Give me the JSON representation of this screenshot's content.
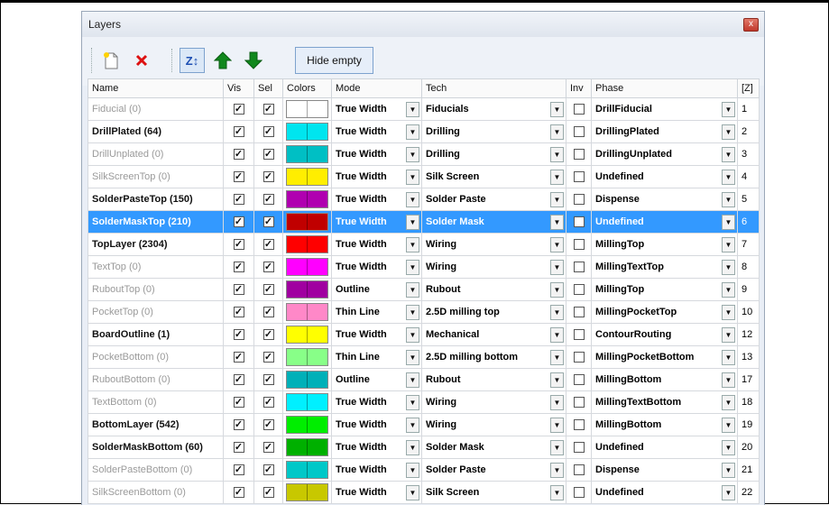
{
  "window": {
    "title": "Layers",
    "close_label": "x"
  },
  "toolbar": {
    "hide_empty_label": "Hide empty",
    "sort_label": "Z↕"
  },
  "columns": [
    "Name",
    "Vis",
    "Sel",
    "Colors",
    "Mode",
    "Tech",
    "Inv",
    "Phase",
    "[Z]"
  ],
  "rows": [
    {
      "name": "Fiducial (0)",
      "empty": true,
      "vis": true,
      "sel": true,
      "colors": [
        "#ffffff",
        "#ffffff"
      ],
      "mode": "True Width",
      "tech": "Fiducials",
      "inv": false,
      "phase": "DrillFiducial",
      "z": "1"
    },
    {
      "name": "DrillPlated (64)",
      "empty": false,
      "vis": true,
      "sel": true,
      "colors": [
        "#00e5ef",
        "#00e5ef"
      ],
      "mode": "True Width",
      "tech": "Drilling",
      "inv": false,
      "phase": "DrillingPlated",
      "z": "2"
    },
    {
      "name": "DrillUnplated (0)",
      "empty": true,
      "vis": true,
      "sel": true,
      "colors": [
        "#00bfc4",
        "#00bfc4"
      ],
      "mode": "True Width",
      "tech": "Drilling",
      "inv": false,
      "phase": "DrillingUnplated",
      "z": "3"
    },
    {
      "name": "SilkScreenTop (0)",
      "empty": true,
      "vis": true,
      "sel": true,
      "colors": [
        "#ffee00",
        "#ffee00"
      ],
      "mode": "True Width",
      "tech": "Silk Screen",
      "inv": false,
      "phase": "Undefined",
      "z": "4"
    },
    {
      "name": "SolderPasteTop (150)",
      "empty": false,
      "vis": true,
      "sel": true,
      "colors": [
        "#b000b0",
        "#b000b0"
      ],
      "mode": "True Width",
      "tech": "Solder Paste",
      "inv": false,
      "phase": "Dispense",
      "z": "5"
    },
    {
      "name": "SolderMaskTop (210)",
      "empty": false,
      "selected": true,
      "vis": true,
      "sel": true,
      "colors": [
        "#c00000",
        "#c00000"
      ],
      "mode": "True Width",
      "tech": "Solder Mask",
      "inv": false,
      "phase": "Undefined",
      "z": "6"
    },
    {
      "name": "TopLayer (2304)",
      "empty": false,
      "vis": true,
      "sel": true,
      "colors": [
        "#ff0000",
        "#ff0000"
      ],
      "mode": "True Width",
      "tech": "Wiring",
      "inv": false,
      "phase": "MillingTop",
      "z": "7"
    },
    {
      "name": "TextTop (0)",
      "empty": true,
      "vis": true,
      "sel": true,
      "colors": [
        "#ff00ff",
        "#ff00ff"
      ],
      "mode": "True Width",
      "tech": "Wiring",
      "inv": false,
      "phase": "MillingTextTop",
      "z": "8"
    },
    {
      "name": "RuboutTop (0)",
      "empty": true,
      "vis": true,
      "sel": true,
      "colors": [
        "#a000a0",
        "#a000a0"
      ],
      "mode": "Outline",
      "tech": "Rubout",
      "inv": false,
      "phase": "MillingTop",
      "z": "9"
    },
    {
      "name": "PocketTop (0)",
      "empty": true,
      "vis": true,
      "sel": true,
      "colors": [
        "#ff88c8",
        "#ff88c8"
      ],
      "mode": "Thin Line",
      "tech": "2.5D milling top",
      "inv": false,
      "phase": "MillingPocketTop",
      "z": "10"
    },
    {
      "name": "BoardOutline (1)",
      "empty": false,
      "vis": true,
      "sel": true,
      "colors": [
        "#ffff00",
        "#ffff00"
      ],
      "mode": "True Width",
      "tech": "Mechanical",
      "inv": false,
      "phase": "ContourRouting",
      "z": "12"
    },
    {
      "name": "PocketBottom (0)",
      "empty": true,
      "vis": true,
      "sel": true,
      "colors": [
        "#88ff88",
        "#88ff88"
      ],
      "mode": "Thin Line",
      "tech": "2.5D milling bottom",
      "inv": false,
      "phase": "MillingPocketBottom",
      "z": "13"
    },
    {
      "name": "RuboutBottom (0)",
      "empty": true,
      "vis": true,
      "sel": true,
      "colors": [
        "#00b0b8",
        "#00b0b8"
      ],
      "mode": "Outline",
      "tech": "Rubout",
      "inv": false,
      "phase": "MillingBottom",
      "z": "17"
    },
    {
      "name": "TextBottom (0)",
      "empty": true,
      "vis": true,
      "sel": true,
      "colors": [
        "#00f0ff",
        "#00f0ff"
      ],
      "mode": "True Width",
      "tech": "Wiring",
      "inv": false,
      "phase": "MillingTextBottom",
      "z": "18"
    },
    {
      "name": "BottomLayer (542)",
      "empty": false,
      "vis": true,
      "sel": true,
      "colors": [
        "#00ee00",
        "#00ee00"
      ],
      "mode": "True Width",
      "tech": "Wiring",
      "inv": false,
      "phase": "MillingBottom",
      "z": "19"
    },
    {
      "name": "SolderMaskBottom (60)",
      "empty": false,
      "vis": true,
      "sel": true,
      "colors": [
        "#00b000",
        "#00b000"
      ],
      "mode": "True Width",
      "tech": "Solder Mask",
      "inv": false,
      "phase": "Undefined",
      "z": "20"
    },
    {
      "name": "SolderPasteBottom (0)",
      "empty": true,
      "vis": true,
      "sel": true,
      "colors": [
        "#00c8c8",
        "#00c8c8"
      ],
      "mode": "True Width",
      "tech": "Solder Paste",
      "inv": false,
      "phase": "Dispense",
      "z": "21"
    },
    {
      "name": "SilkScreenBottom (0)",
      "empty": true,
      "vis": true,
      "sel": true,
      "colors": [
        "#c8c800",
        "#c8c800"
      ],
      "mode": "True Width",
      "tech": "Silk Screen",
      "inv": false,
      "phase": "Undefined",
      "z": "22"
    }
  ]
}
